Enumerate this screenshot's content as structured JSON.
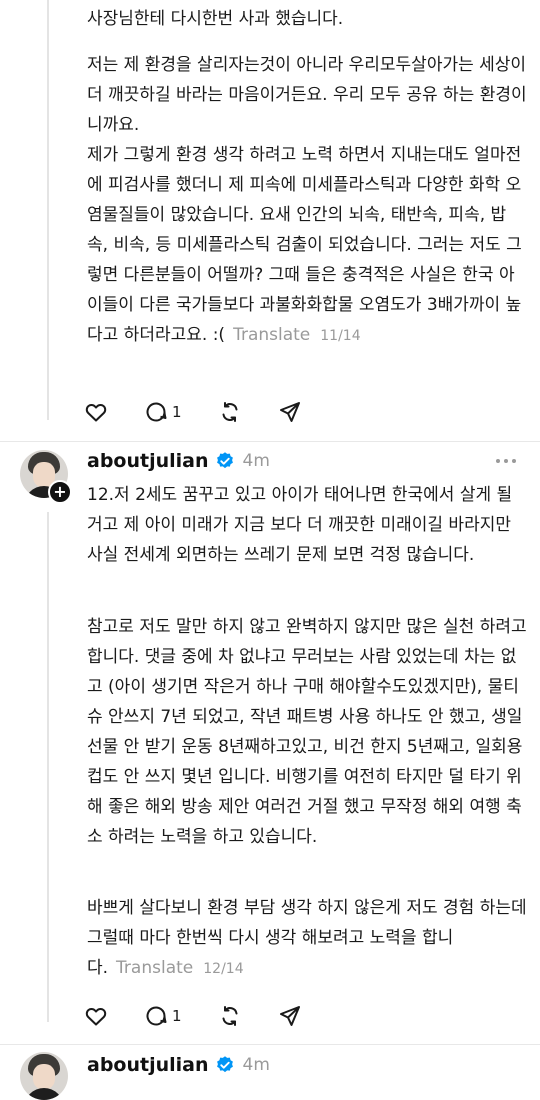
{
  "top_post": {
    "cutoff_line": "사장님한테 다시한번 사과 했습니다.",
    "para2": "저는 제 환경을 살리자는것이 아니라 우리모두살아가는 세상이 더 깨끗하길 바라는 마음이거든요. 우리 모두 공유 하는 환경이니까요.",
    "para3": "제가 그렇게 환경 생각 하려고 노력 하면서 지내는대도 얼마전에 피검사를 했더니 제 피속에 미세플라스틱과 다양한 화학 오염물질들이 많았습니다. 요새 인간의 뇌속, 태반속, 피속, 밥속, 비속, 등 미세플라스틱 검출이 되었습니다. 그러는 저도 그렇면 다른분들이 어떨까? 그때 들은 충격적은 사실은 한국 아이들이 다른 국가들보다 과불화화합물 오염도가 3배가까이 높다고 하더라고요. :(",
    "translate": "Translate",
    "page": "11/14",
    "reply_count": "1"
  },
  "post2": {
    "username": "aboutjulian",
    "time": "4m",
    "para1": "12.저 2세도 꿈꾸고 있고 아이가 태어나면 한국에서 살게 될거고 제 아이 미래가 지금 보다 더 깨끗한 미래이길 바라지만 사실 전세계 외면하는 쓰레기 문제 보면 걱정 많습니다.",
    "para2": "참고로 저도 말만 하지 않고 완벽하지 않지만 많은 실천 하려고 합니다. 댓글 중에 차 없냐고 무러보는 사람 있었는데 차는 없고 (아이 생기면 작은거 하나 구매 해야할수도있겠지만), 물티슈 안쓰지 7년 되었고, 작년 패트병 사용 하나도 안 했고, 생일 선물 안 받기 운동 8년째하고있고, 비건 한지 5년째고, 일회용컵도 안 쓰지 몇년 입니다. 비행기를 여전히 타지만 덜 타기 위해 좋은 해외 방송 제안 여러건 거절 했고 무작정 해외 여행 축소 하려는 노력을 하고 있습니다.",
    "para3": "바쁘게 살다보니 환경 부담 생각 하지 않은게 저도 경험 하는데 그럴때 마다 한번씩 다시 생각 해보려고 노력을 합니다.",
    "translate": "Translate",
    "page": "12/14",
    "reply_count": "1"
  },
  "post3": {
    "username": "aboutjulian",
    "time": "4m"
  },
  "icons": {
    "like": "heart-icon",
    "reply": "comment-icon",
    "repost": "repost-icon",
    "share": "send-icon",
    "verified": "verified-badge-icon",
    "more": "more-dots-icon",
    "follow": "plus-icon"
  },
  "colors": {
    "verified": "#0095f6",
    "muted": "#9a9a9a",
    "text": "#1a1a1a"
  }
}
